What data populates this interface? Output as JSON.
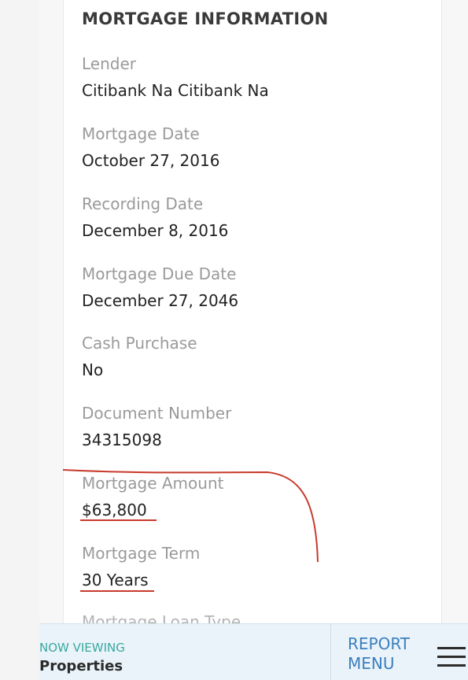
{
  "section": {
    "title": "MORTGAGE INFORMATION"
  },
  "fields": [
    {
      "label": "Lender",
      "value": "Citibank Na Citibank Na"
    },
    {
      "label": "Mortgage Date",
      "value": "October 27, 2016"
    },
    {
      "label": "Recording Date",
      "value": "December 8, 2016"
    },
    {
      "label": "Mortgage Due Date",
      "value": "December 27, 2046"
    },
    {
      "label": "Cash Purchase",
      "value": "No"
    },
    {
      "label": "Document Number",
      "value": "34315098"
    },
    {
      "label": "Mortgage Amount",
      "value": "$63,800"
    },
    {
      "label": "Mortgage Term",
      "value": "30 Years"
    }
  ],
  "partial_label": "Mortgage Loan Type",
  "bottom_bar": {
    "now_viewing": "NOW VIEWING",
    "current": "Properties",
    "report_menu_line1": "REPORT",
    "report_menu_line2": "MENU",
    "menu_icon": "hamburger-icon"
  },
  "colors": {
    "annotation": "#c8392b",
    "now_viewing": "#37a8a0",
    "report_menu": "#3b7fbf",
    "bar_background": "#eaf3f9"
  }
}
